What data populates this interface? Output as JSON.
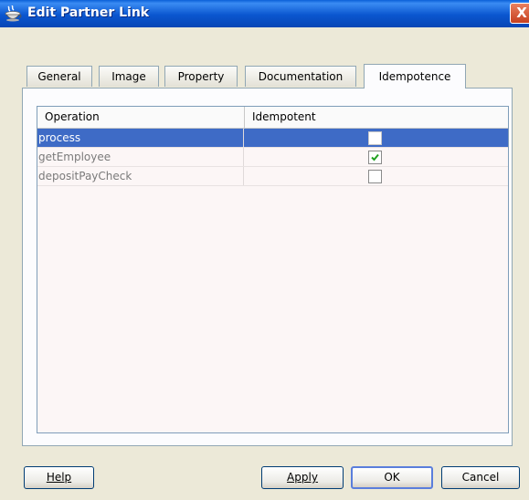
{
  "window": {
    "title": "Edit Partner Link",
    "close_label": "X"
  },
  "tabs": [
    {
      "label": "General",
      "active": false
    },
    {
      "label": "Image",
      "active": false
    },
    {
      "label": "Property",
      "active": false
    },
    {
      "label": "Documentation",
      "active": false
    },
    {
      "label": "Idempotence",
      "active": true
    }
  ],
  "table": {
    "columns": [
      "Operation",
      "Idempotent"
    ],
    "rows": [
      {
        "operation": "process",
        "idempotent": false,
        "selected": true
      },
      {
        "operation": "getEmployee",
        "idempotent": true,
        "selected": false
      },
      {
        "operation": "depositPayCheck",
        "idempotent": false,
        "selected": false
      }
    ]
  },
  "buttons": {
    "help_label": "Help",
    "apply_label": "Apply",
    "ok_label": "OK",
    "cancel_label": "Cancel"
  },
  "colors": {
    "titlebar": "#0a56cf",
    "selection": "#3e6bc6",
    "dialog_bg": "#ece9d8"
  }
}
